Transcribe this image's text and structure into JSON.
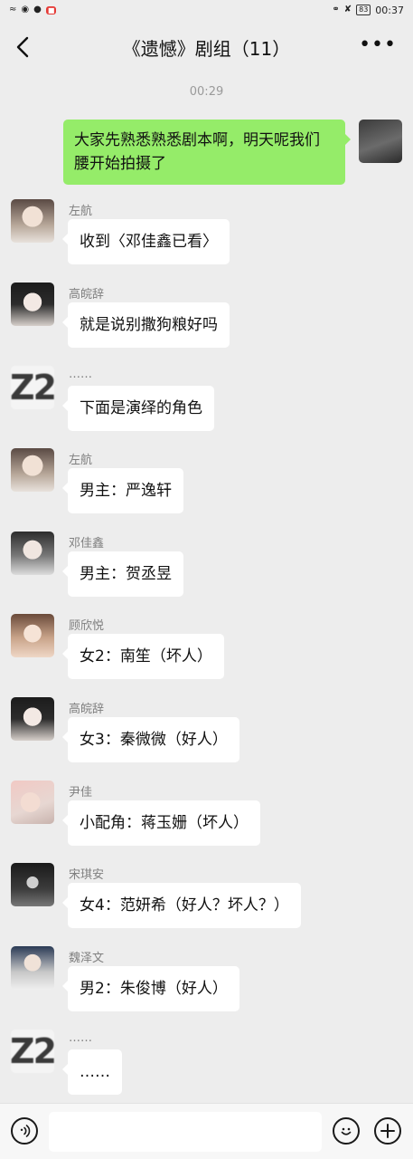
{
  "status_bar": {
    "left_icons": [
      "wifi-icon",
      "app-icon-1",
      "app-icon-2",
      "app-icon-red"
    ],
    "battery": "83",
    "time": "00:37"
  },
  "header": {
    "title": "《遗憾》剧组（11）"
  },
  "chat": {
    "timestamp": "00:29",
    "messages": [
      {
        "side": "right",
        "sender": "",
        "text": "大家先熟悉熟悉剧本啊，明天呢我们腰开始拍摄了"
      },
      {
        "side": "left",
        "sender": "左航",
        "text": "收到〈邓佳鑫已看〉"
      },
      {
        "side": "left",
        "sender": "高皖辞",
        "text": "就是说别撒狗粮好吗"
      },
      {
        "side": "left",
        "sender": "……",
        "text": "下面是演绎的角色"
      },
      {
        "side": "left",
        "sender": "左航",
        "text": "男主：严逸轩"
      },
      {
        "side": "left",
        "sender": "邓佳鑫",
        "text": "男主：贺丞昱"
      },
      {
        "side": "left",
        "sender": "顾欣悦",
        "text": "女2：南笙（坏人）"
      },
      {
        "side": "left",
        "sender": "高皖辞",
        "text": "女3：秦微微（好人）"
      },
      {
        "side": "left",
        "sender": "尹佳",
        "text": "小配角：蒋玉姗（坏人）"
      },
      {
        "side": "left",
        "sender": "宋琪安",
        "text": "女4：范妍希（好人？坏人？）"
      },
      {
        "side": "left",
        "sender": "魏泽文",
        "text": "男2：朱俊博（好人）"
      },
      {
        "side": "left",
        "sender": "……",
        "text": "……"
      }
    ]
  },
  "input_bar": {
    "placeholder": "",
    "voice_icon": "voice-icon",
    "emoji_icon": "emoji-icon",
    "plus_icon": "plus-icon"
  },
  "colors": {
    "background": "#ededed",
    "own_bubble": "#95ec69",
    "other_bubble": "#ffffff"
  }
}
